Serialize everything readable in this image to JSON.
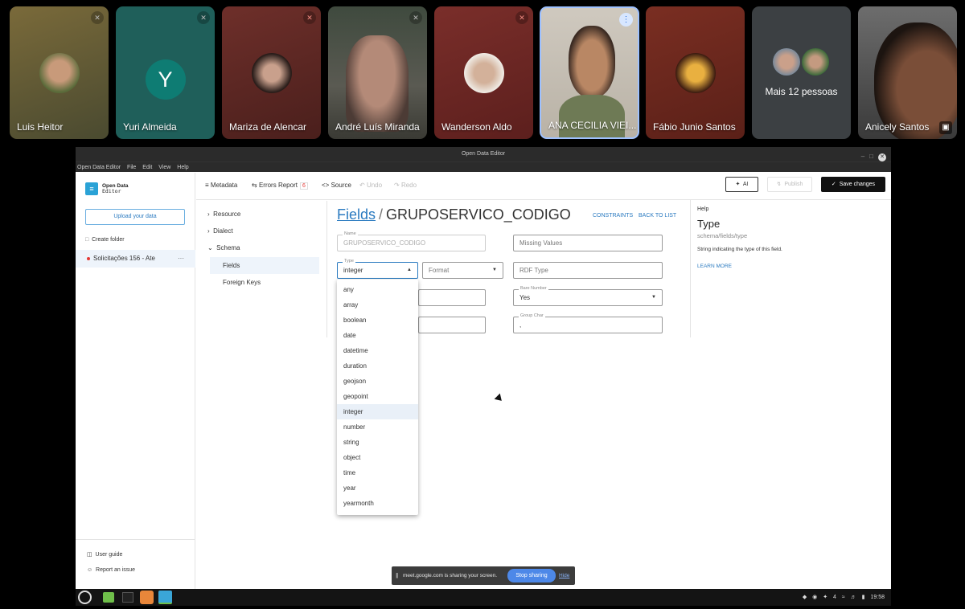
{
  "meet": {
    "participants": [
      {
        "name": "Luis Heitor"
      },
      {
        "name": "Yuri Almeida",
        "initial": "Y"
      },
      {
        "name": "Mariza de Alencar"
      },
      {
        "name": "André Luís Miranda"
      },
      {
        "name": "Wanderson Aldo"
      },
      {
        "name": "ANA CECILIA VIEI..."
      },
      {
        "name": "Fábio Junio Santos"
      },
      {
        "name": "Anicely Santos"
      }
    ],
    "more_label": "Mais 12 pessoas",
    "muted_icon": "mic-off-icon"
  },
  "window": {
    "title": "Open Data Editor",
    "menu": [
      "Open Data Editor",
      "File",
      "Edit",
      "View",
      "Help"
    ]
  },
  "sidebar": {
    "logo_name": "Open Data",
    "logo_sub": "Editor",
    "upload_label": "Upload your data",
    "create_folder_label": "Create folder",
    "file_name": "Solicitações 156 - Ate",
    "more_glyph": "···",
    "user_guide_label": "User guide",
    "report_issue_label": "Report an issue"
  },
  "toolbar": {
    "metadata_label": "Metadata",
    "errors_label": "Errors Report",
    "errors_count": "6",
    "source_label": "Source",
    "undo_label": "Undo",
    "redo_label": "Redo",
    "ai_label": "AI",
    "publish_label": "Publish",
    "save_label": "Save changes"
  },
  "nav": {
    "resource_label": "Resource",
    "dialect_label": "Dialect",
    "schema_label": "Schema",
    "fields_label": "Fields",
    "foreign_keys_label": "Foreign Keys"
  },
  "editor": {
    "crumb_link": "Fields",
    "crumb_sep": "/",
    "crumb_current": "GRUPOSERVICO_CODIGO",
    "constraints_label": "CONSTRAINTS",
    "back_label": "BACK TO LIST",
    "name_label": "Name",
    "name_value": "GRUPOSERVICO_CODIGO",
    "missing_values_placeholder": "Missing Values",
    "type_label": "Type",
    "type_value": "integer",
    "format_placeholder": "Format",
    "rdf_placeholder": "RDF Type",
    "bare_number_label": "Bare Number",
    "bare_number_value": "Yes",
    "group_char_label": "Group Char",
    "group_char_value": ","
  },
  "type_options": [
    "any",
    "array",
    "boolean",
    "date",
    "datetime",
    "duration",
    "geojson",
    "geopoint",
    "integer",
    "number",
    "string",
    "object",
    "time",
    "year",
    "yearmonth"
  ],
  "selected_type": "integer",
  "help": {
    "title": "Help",
    "heading": "Type",
    "path": "schema/fields/type",
    "description": "String indicating the type of this field.",
    "learn_more": "LEARN MORE"
  },
  "share_bar": {
    "message": "meet.google.com is sharing your screen.",
    "stop_label": "Stop sharing",
    "hide_label": "Hide"
  },
  "taskbar": {
    "badge_count": "4",
    "clock": "19:58"
  },
  "colors": {
    "accent": "#2a7ac0",
    "error": "#e53935",
    "meet_blue": "#4d88e8"
  }
}
